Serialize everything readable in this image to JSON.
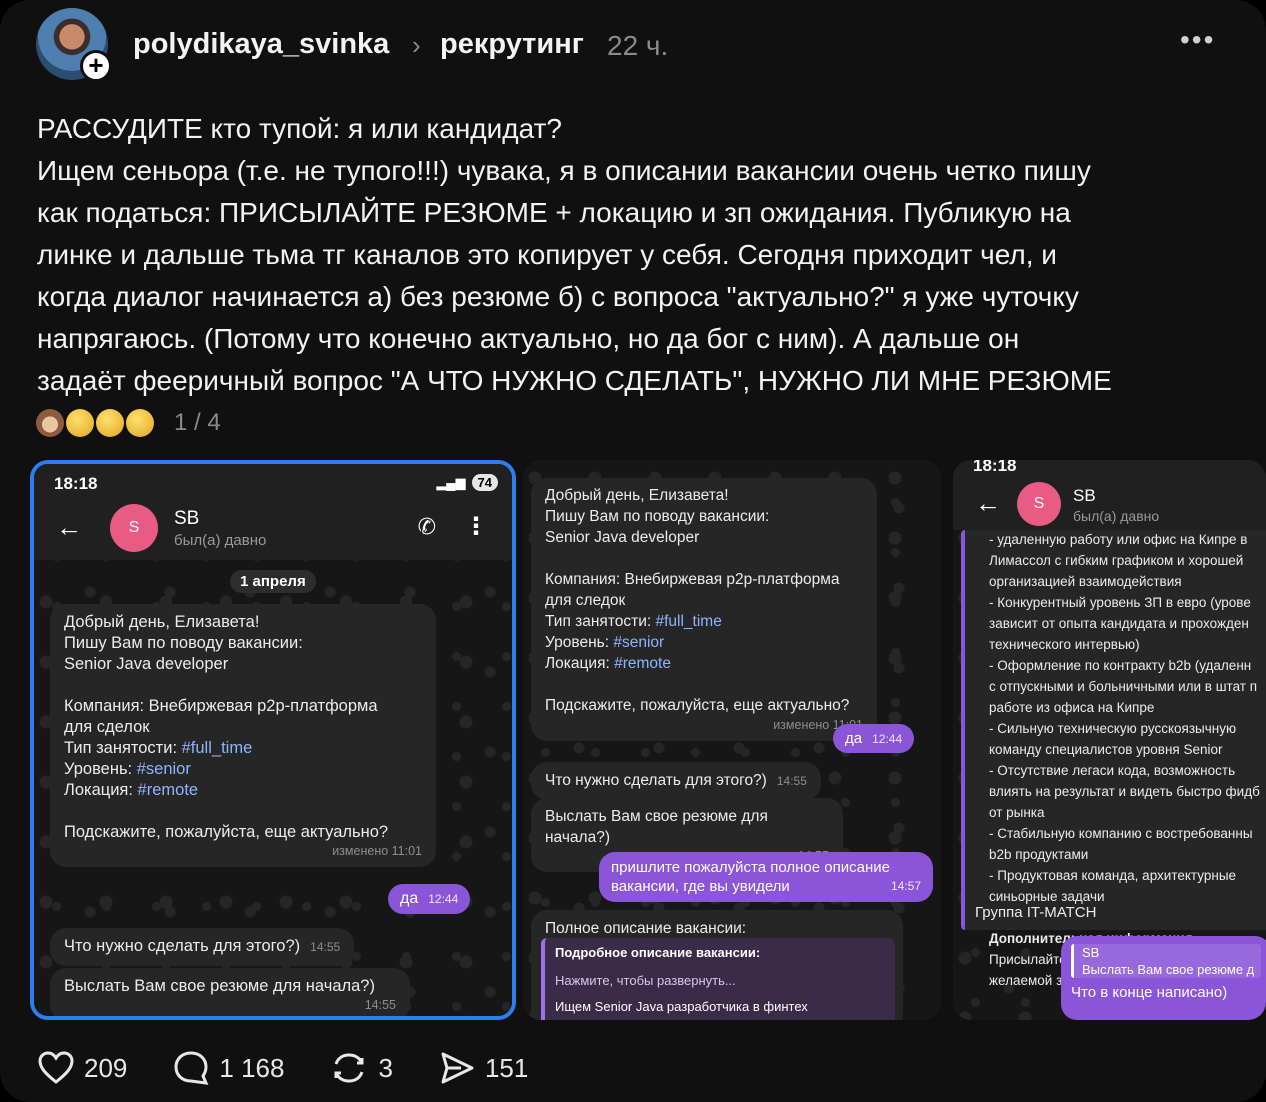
{
  "header": {
    "username": "polydikaya_svinka",
    "topic": "рекрутинг",
    "time": "22 ч.",
    "more_icon": "more-horizontal-icon"
  },
  "post": {
    "lines": [
      "РАССУДИТЕ кто тупой: я или кандидат?",
      "Ищем сеньора (т.е. не тупого!!!) чувака, я в описании вакансии очень четко пишу",
      "как податься: ПРИСЫЛАЙТЕ РЕЗЮМЕ + локацию и зп ожидания. Публикую на",
      "линке и дальше тьма тг каналов это копирует у себя. Сегодня приходит чел, и",
      "когда диалог начинается а) без резюме б) с вопроса \"актуально?\" я уже чуточку",
      "напрягаюсь. (Потому что конечно актуально, но да бог с ним). А дальше он",
      "задаёт фееричный вопрос \"А ЧТО НУЖНО СДЕЛАТЬ\", НУЖНО ЛИ МНЕ РЕЗЮМЕ"
    ],
    "emoji_icons": [
      "see-no-evil-monkey-icon",
      "zany-face-icon",
      "thinking-face-icon",
      "shushing-face-icon"
    ],
    "image_counter": "1 / 4"
  },
  "shot1": {
    "clock": "18:18",
    "battery": "74",
    "contact_initial": "S",
    "contact_name": "SB",
    "contact_status": "был(а) давно",
    "date": "1 апреля",
    "message_lines": [
      "Добрый день, Елизавета!",
      "Пишу Вам по поводу вакансии:",
      "Senior Java developer",
      "",
      "Компания: Внебиржевая p2p-платформа",
      "для сделок"
    ],
    "employment_label": "Тип занятости: ",
    "employment_tag": "#full_time",
    "level_label": "Уровень: ",
    "level_tag": "#senior",
    "location_label": "Локация: ",
    "location_tag": "#remote",
    "question": "Подскажите, пожалуйста, еще актуально?",
    "edited": "изменено 11:01",
    "reply_text": "да",
    "reply_time": "12:44",
    "msg2": "Что нужно сделать для этого?)",
    "msg2_time": "14:55",
    "msg3": "Выслать Вам свое резюме для начала?)",
    "msg3_time": "14:55"
  },
  "shot2": {
    "message_lines": [
      "Добрый день, Елизавета!",
      "Пишу Вам по поводу вакансии:",
      "Senior Java developer",
      "",
      "Компания: Внебиржевая p2p-платформа",
      "для следок"
    ],
    "employment_label": "Тип занятости: ",
    "employment_tag": "#full_time",
    "level_label": "Уровень: ",
    "level_tag": "#senior",
    "location_label": "Локация: ",
    "location_tag": "#remote",
    "question": "Подскажите, пожалуйста, еще актуально?",
    "edited": "изменено 11:01",
    "reply_text": "да",
    "reply_time": "12:44",
    "msg2": "Что нужно сделать для этого?)",
    "msg2_time": "14:55",
    "msg3": "Выслать Вам свое резюме для начала?)",
    "msg3_time": "14:55",
    "out_line1": "пришлите пожалуйста полное описание",
    "out_line2": "вакансии, где вы увидели",
    "out_time": "14:57",
    "full_desc_title": "Полное описание вакансии:",
    "quote_title": "Подробное описание вакансии:",
    "quote_hint": "Нажмите, чтобы развернуть...",
    "quote_cut": "Ищем Senior Java разработчика в финтех"
  },
  "shot3": {
    "clock": "18:18",
    "contact_initial": "S",
    "contact_name": "SB",
    "contact_status": "был(а) давно",
    "lines": [
      "- удаленную работу или офис на Кипре в",
      "Лимассол с гибким графиком и хорошей",
      "организацией взаимодействия",
      "- Конкурентный уровень ЗП в евро (урове",
      "зависит от опыта кандидата и прохожден",
      "технического интервью)",
      "- Оформление по контракту b2b (удаленн",
      "с отпускными и больничными или в штат п",
      "работе из офиса на Кипре",
      "- Сильную техническую русскоязычную",
      "команду специалистов уровня Senior",
      "- Отсутствие легаси кода, возможность",
      "влиять на результат и видеть быстро фидб",
      "от рынка",
      "- Стабильную компанию с востребованны",
      "b2b продуктами",
      "- Продуктовая команда, архитектурные",
      "синьорные задачи"
    ],
    "extra_title": "Дополнительная информация",
    "extra_line1": "Присылайте резюме + локация / уровень",
    "extra_line2": "желаемой зп в евро гросс",
    "group": "Группа IT-MATCH",
    "reply_sender": "SB",
    "reply_quote": "Выслать Вам свое резюме д",
    "reply_text": "Что в конце написано)"
  },
  "actions": {
    "likes": "209",
    "comments": "1 168",
    "reposts": "3",
    "shares": "151"
  }
}
